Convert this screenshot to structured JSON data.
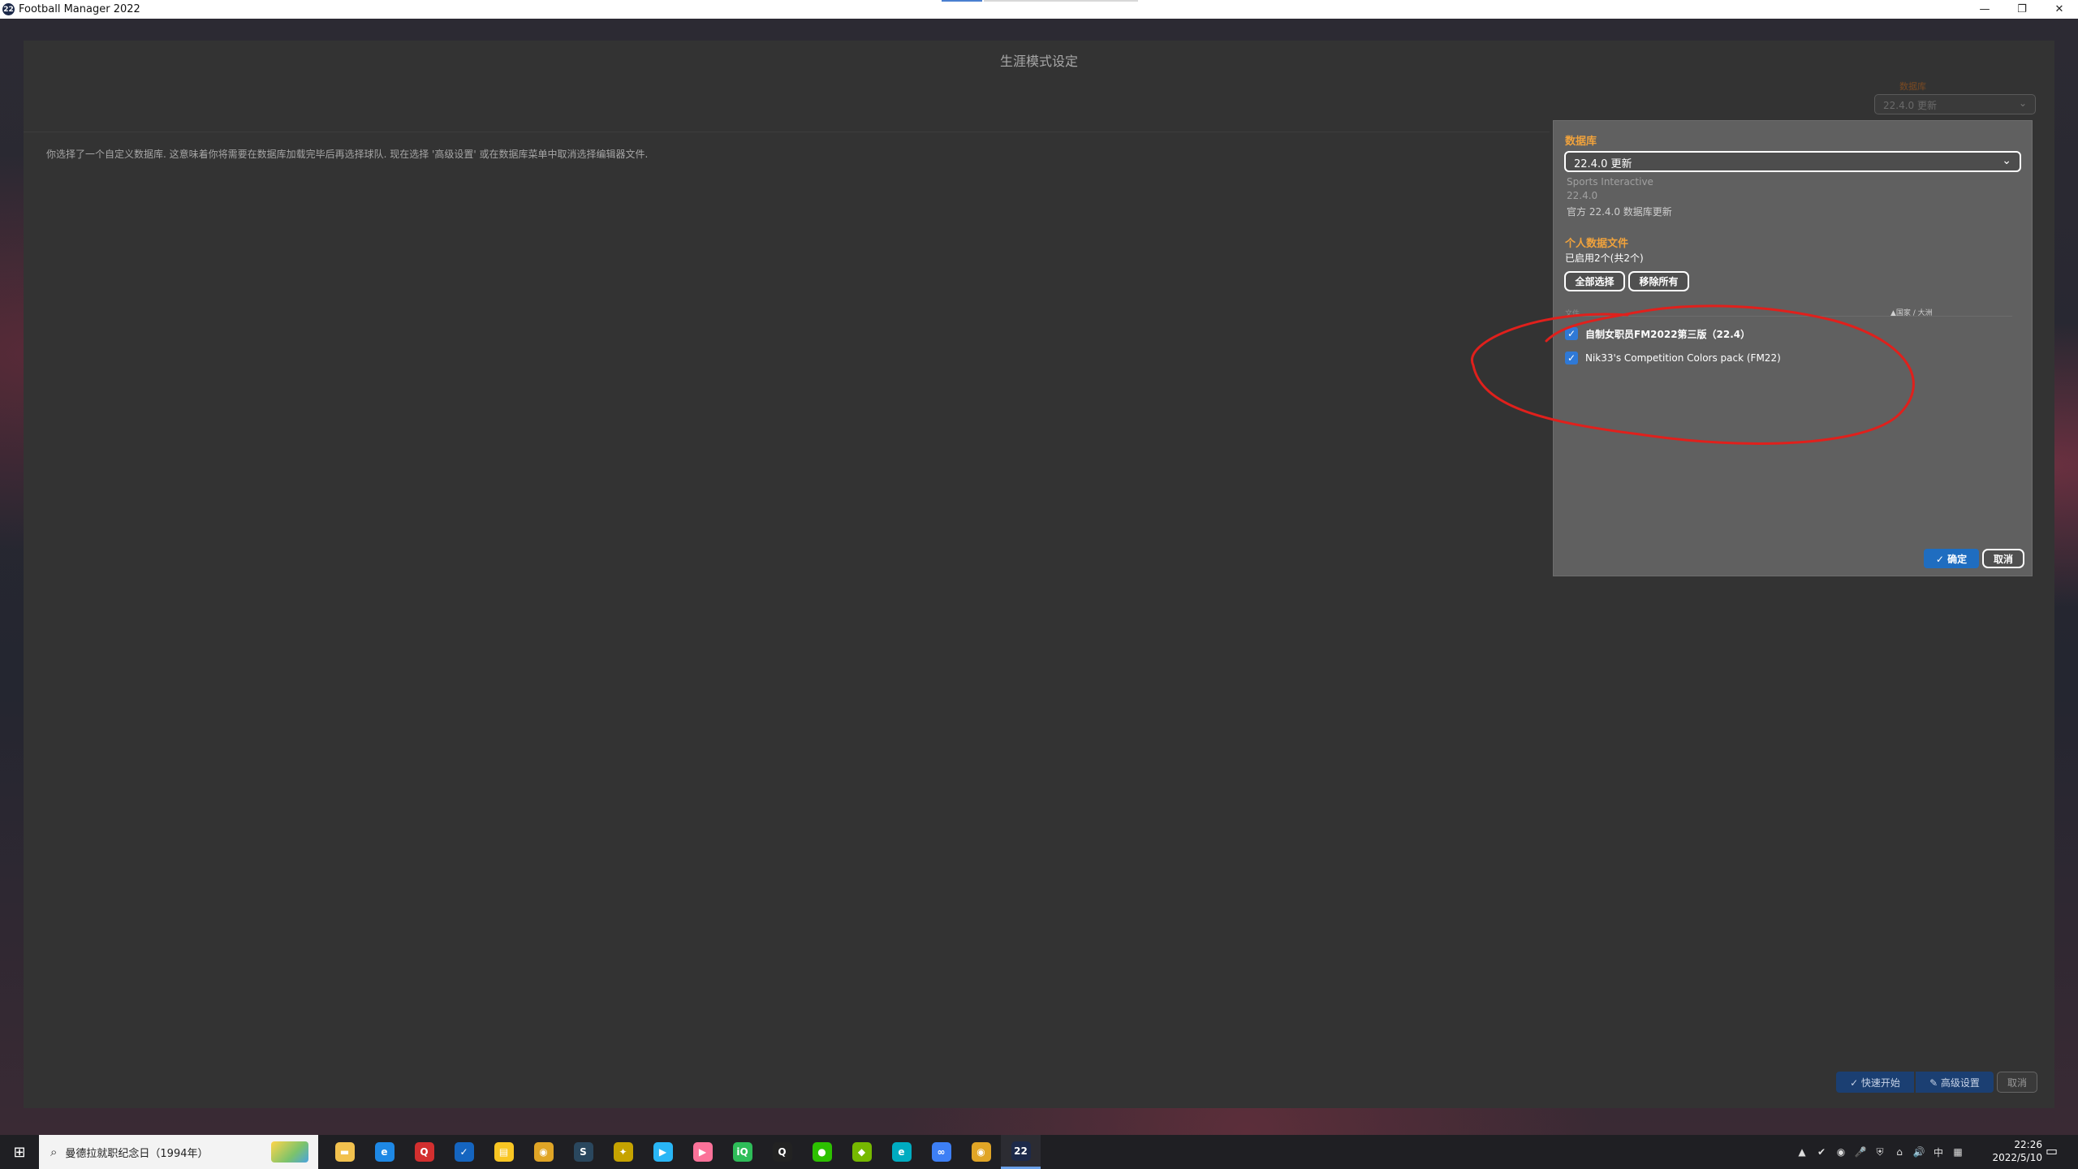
{
  "window": {
    "title": "Football Manager 2022",
    "app_icon": "22",
    "minimize": "—",
    "maximize": "❐",
    "close": "✕"
  },
  "main": {
    "page_title": "生涯模式设定",
    "info_text": "你选择了一个自定义数据库. 这意味着你将需要在数据库加载完毕后再选择球队. 现在选择 '高级设置' 或在数据库菜单中取消选择编辑器文件.",
    "top_db_label": "数据库",
    "top_db_value": "22.4.0 更新"
  },
  "db_popup": {
    "db_label": "数据库",
    "db_value": "22.4.0 更新",
    "publisher": "Sports Interactive",
    "version": "22.4.0",
    "description": "官方 22.4.0 数据库更新",
    "personal_label": "个人数据文件",
    "enabled_count": "已启用2个(共2个)",
    "select_all": "全部选择",
    "remove_all": "移除所有",
    "col_file": "文件",
    "col_sort": "▲国家 / 大洲",
    "files": [
      {
        "name": "自制女职员FM2022第三版（22.4）",
        "checked": true
      },
      {
        "name": "Nik33's Competition Colors pack (FM22)",
        "checked": true
      }
    ],
    "confirm": "✓ 确定",
    "cancel": "取消"
  },
  "bottom_actions": {
    "quick_start": "✓ 快速开始",
    "advanced": "✎ 高级设置",
    "cancel": "取消"
  },
  "taskbar": {
    "search_text": "曼德拉就职纪念日（1994年）",
    "icons": [
      {
        "name": "file-explorer-icon",
        "color": "#f2c14e",
        "glyph": "▬"
      },
      {
        "name": "edge-icon",
        "color": "#1e88e5",
        "glyph": "e"
      },
      {
        "name": "app-red-icon",
        "color": "#d32f2f",
        "glyph": "Q"
      },
      {
        "name": "app-blue-icon",
        "color": "#1565c0",
        "glyph": "✓"
      },
      {
        "name": "notes-icon",
        "color": "#f9c623",
        "glyph": "▤"
      },
      {
        "name": "owl-icon",
        "color": "#e0a526",
        "glyph": "◉"
      },
      {
        "name": "steam-icon",
        "color": "#2a475e",
        "glyph": "S"
      },
      {
        "name": "app-yellow-icon",
        "color": "#c6a300",
        "glyph": "✦"
      },
      {
        "name": "video-play-icon",
        "color": "#29b6f6",
        "glyph": "▶"
      },
      {
        "name": "bilibili-icon",
        "color": "#fb7299",
        "glyph": "▶"
      },
      {
        "name": "iqiyi-icon",
        "color": "#2ebd59",
        "glyph": "iQ"
      },
      {
        "name": "qq-icon",
        "color": "#222222",
        "glyph": "Q"
      },
      {
        "name": "wechat-icon",
        "color": "#2dc100",
        "glyph": "●"
      },
      {
        "name": "nvidia-icon",
        "color": "#76b900",
        "glyph": "◆"
      },
      {
        "name": "app-teal-icon",
        "color": "#00acc1",
        "glyph": "e"
      },
      {
        "name": "baidu-netdisk-icon",
        "color": "#3d7ff5",
        "glyph": "∞"
      },
      {
        "name": "owl2-icon",
        "color": "#e0a526",
        "glyph": "◉"
      },
      {
        "name": "fm22-icon",
        "color": "#1d2a4a",
        "glyph": "22"
      }
    ],
    "tray": [
      "▲",
      "✔",
      "◉",
      "🎤",
      "⛨",
      "⌂",
      "🔊",
      "中",
      "▦"
    ],
    "time": "22:26",
    "date": "2022/5/10",
    "notifications": "▭"
  },
  "colors": {
    "accent_orange": "#f0a23c",
    "checkbox_blue": "#2f79d6",
    "confirm_blue": "#1f6dc0",
    "annotation_red": "#e0201c"
  }
}
